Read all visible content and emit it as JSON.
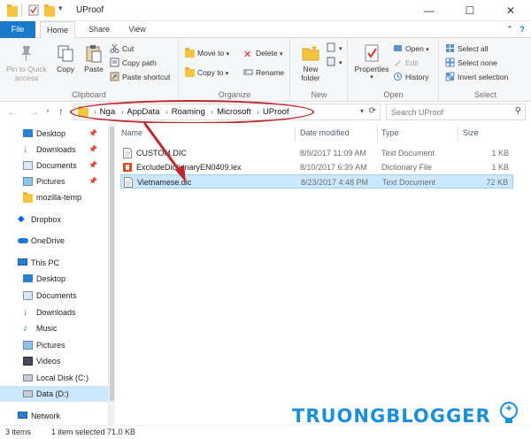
{
  "window": {
    "title": "UProof",
    "controls": {
      "minimize": "—",
      "maximize": "☐",
      "close": "✕"
    }
  },
  "ribbon_tabs": {
    "file": "File",
    "home": "Home",
    "share": "Share",
    "view": "View"
  },
  "ribbon": {
    "clipboard": {
      "label": "Clipboard",
      "pin_to_quick_access_line1": "Pin to Quick",
      "pin_to_quick_access_line2": "access",
      "copy": "Copy",
      "paste": "Paste",
      "cut": "Cut",
      "copy_path": "Copy path",
      "paste_shortcut": "Paste shortcut"
    },
    "organize": {
      "label": "Organize",
      "move_to": "Move to",
      "copy_to": "Copy to",
      "delete": "Delete",
      "rename": "Rename"
    },
    "new": {
      "label": "New",
      "new_folder_line1": "New",
      "new_folder_line2": "folder"
    },
    "open": {
      "label": "Open",
      "properties": "Properties",
      "open": "Open",
      "edit": "Edit",
      "history": "History"
    },
    "select": {
      "label": "Select",
      "select_all": "Select all",
      "select_none": "Select none",
      "invert_selection": "Invert selection"
    }
  },
  "address": {
    "crumbs": [
      "Nga",
      "AppData",
      "Roaming",
      "Microsoft",
      "UProof"
    ],
    "search_placeholder": "Search UProof"
  },
  "nav": {
    "quick_access": [
      {
        "label": "Desktop",
        "icon": "desktop-icon",
        "pinned": true
      },
      {
        "label": "Downloads",
        "icon": "downloads-icon",
        "pinned": true
      },
      {
        "label": "Documents",
        "icon": "documents-icon",
        "pinned": true
      },
      {
        "label": "Pictures",
        "icon": "pictures-icon",
        "pinned": true
      },
      {
        "label": "mozilla-temp",
        "icon": "folder-icon",
        "pinned": false
      }
    ],
    "dropbox": "Dropbox",
    "onedrive": "OneDrive",
    "this_pc": "This PC",
    "this_pc_items": [
      {
        "label": "Desktop",
        "icon": "desktop-icon"
      },
      {
        "label": "Documents",
        "icon": "documents-icon"
      },
      {
        "label": "Downloads",
        "icon": "downloads-icon"
      },
      {
        "label": "Music",
        "icon": "music-icon"
      },
      {
        "label": "Pictures",
        "icon": "pictures-icon"
      },
      {
        "label": "Videos",
        "icon": "videos-icon"
      },
      {
        "label": "Local Disk (C:)",
        "icon": "drive-c-icon"
      },
      {
        "label": "Data (D:)",
        "icon": "drive-d-icon",
        "selected": true
      }
    ],
    "network": "Network"
  },
  "columns": {
    "name": "Name",
    "date": "Date modified",
    "type": "Type",
    "size": "Size"
  },
  "files": [
    {
      "name": "CUSTOM.DIC",
      "date": "8/9/2017 11:09 AM",
      "type": "Text Document",
      "size": "1 KB",
      "icon": "text-file-icon",
      "selected": false
    },
    {
      "name": "ExcludeDictionaryEN0409.lex",
      "date": "8/10/2017 6:39 AM",
      "type": "Dictionary File",
      "size": "1 KB",
      "icon": "office-file-icon",
      "selected": false
    },
    {
      "name": "Vietnamese.dic",
      "date": "8/23/2017 4:48 PM",
      "type": "Text Document",
      "size": "72 KB",
      "icon": "text-file-icon",
      "selected": true
    }
  ],
  "status": {
    "items": "3 items",
    "selected": "1 item selected  71.0 KB"
  },
  "watermark": "TRUONGBLOGGER",
  "colors": {
    "accent": "#1979ca",
    "selection": "#cce8ff",
    "annotation": "#c0282e",
    "watermark": "#1b90d8"
  }
}
